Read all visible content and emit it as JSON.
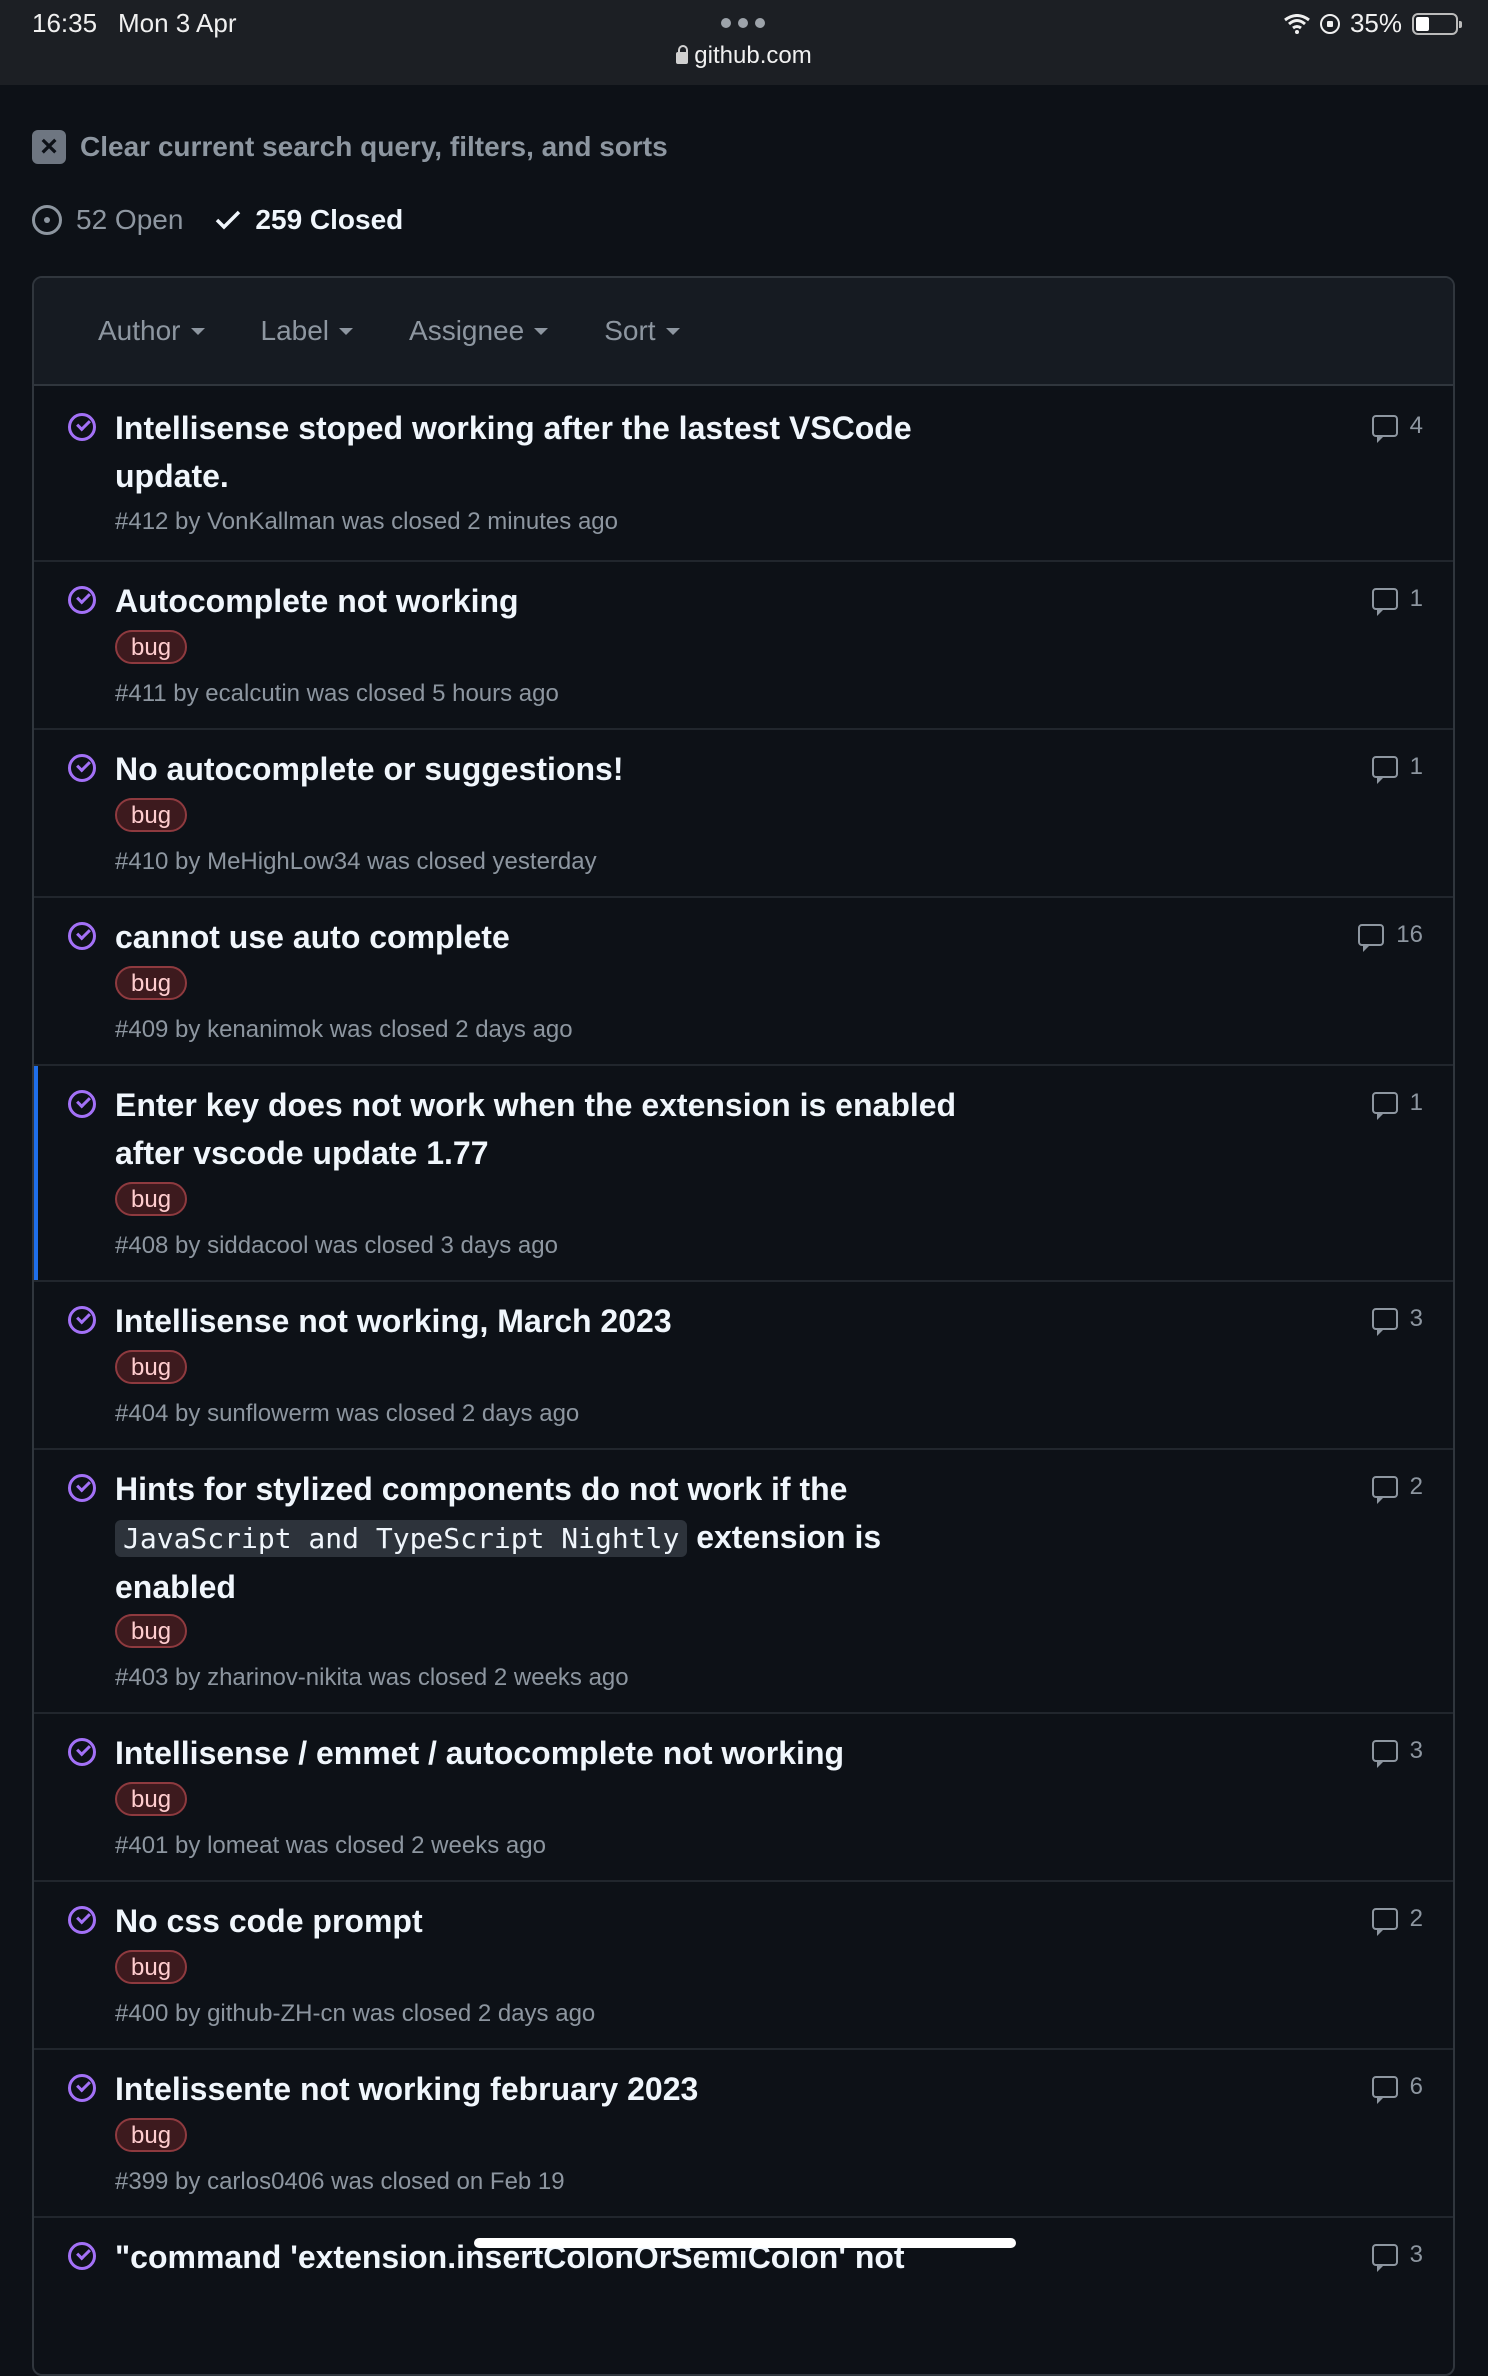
{
  "status_bar": {
    "time": "16:35",
    "date": "Mon 3 Apr",
    "url": "github.com",
    "battery": "35%",
    "battery_level": 0.35
  },
  "clear_text": "Clear current search query, filters, and sorts",
  "states": {
    "open": "52 Open",
    "closed": "259 Closed"
  },
  "filters": [
    "Author",
    "Label",
    "Assignee",
    "Sort"
  ],
  "colors": {
    "background": "#0d1117",
    "closed_icon": "#a371f7",
    "selected_bar": "#1f6feb",
    "label_bug": "#3d1a1e"
  },
  "issues": [
    {
      "title": "Intellisense stoped working after the lastest VSCode update.",
      "label": "",
      "meta": "#412 by VonKallman was closed 2 minutes ago",
      "comments": "4"
    },
    {
      "title": "Autocomplete not working",
      "label": "bug",
      "meta": "#411 by ecalcutin was closed 5 hours ago",
      "comments": "1"
    },
    {
      "title": "No autocomplete or suggestions!",
      "label": "bug",
      "meta": "#410 by MeHighLow34 was closed yesterday",
      "comments": "1"
    },
    {
      "title": "cannot use auto complete",
      "label": "bug",
      "meta": "#409 by kenanimok was closed 2 days ago",
      "comments": "16"
    },
    {
      "title": "Enter key does not work when the extension is enabled after vscode update 1.77",
      "label": "bug",
      "meta": "#408 by siddacool was closed 3 days ago",
      "comments": "1"
    },
    {
      "title": "Intellisense not working, March 2023",
      "label": "bug",
      "meta": "#404 by sunflowerm was closed 2 days ago",
      "comments": "3"
    },
    {
      "title_pre": "Hints for stylized components do not work if the",
      "title_code": "JavaScript and TypeScript Nightly",
      "title_post": "extension is enabled",
      "label": "bug",
      "meta": "#403 by zharinov-nikita was closed 2 weeks ago",
      "comments": "2"
    },
    {
      "title": "Intellisense / emmet / autocomplete not working",
      "label": "bug",
      "meta": "#401 by lomeat was closed 2 weeks ago",
      "comments": "3"
    },
    {
      "title": "No css code prompt",
      "label": "bug",
      "meta": "#400 by github-ZH-cn was closed 2 days ago",
      "comments": "2"
    },
    {
      "title": "Intelissente not working february 2023",
      "label": "bug",
      "meta": "#399 by carlos0406 was closed on Feb 19",
      "comments": "6"
    },
    {
      "title": "\"command 'extension.insertColonOrSemiColon' not",
      "label": "",
      "meta": "",
      "comments": "3"
    }
  ]
}
